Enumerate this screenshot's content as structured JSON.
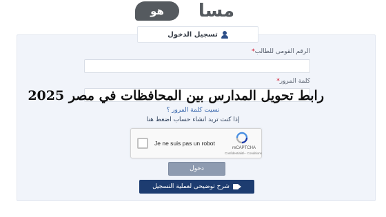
{
  "logo": {
    "bubble_text": "هو",
    "text": "مسا"
  },
  "tab": {
    "label": "تسجيل الدخول"
  },
  "form": {
    "national_id": {
      "label": "الرقم القومى للطالب",
      "required_mark": "*",
      "value": "",
      "placeholder": ""
    },
    "password": {
      "label": "كلمة المرور",
      "required_mark": "*",
      "value": "",
      "placeholder": ""
    }
  },
  "overlay_title": "رابط تحويل المدارس بين المحافظات في مصر 2025",
  "links": {
    "forgot_password": "نسيت كلمة المرور ؟",
    "register": "إذا كنت تريد انشاء حساب اضغط هنا"
  },
  "captcha": {
    "label": "Je ne suis pas un robot",
    "brand": "reCAPTCHA",
    "terms": "Confidentialité - Conditions"
  },
  "buttons": {
    "login": "دخول",
    "video_guide": "شرح توضيحى لعملية التسجيل"
  },
  "icons": {
    "user": "user-icon",
    "video": "video-camera-icon",
    "recaptcha": "recaptcha-logo-icon"
  },
  "colors": {
    "primary": "#1d3c70",
    "panel_bg": "#f1f4fa",
    "login_button": "#8e9bb0",
    "required": "#d0021b"
  }
}
